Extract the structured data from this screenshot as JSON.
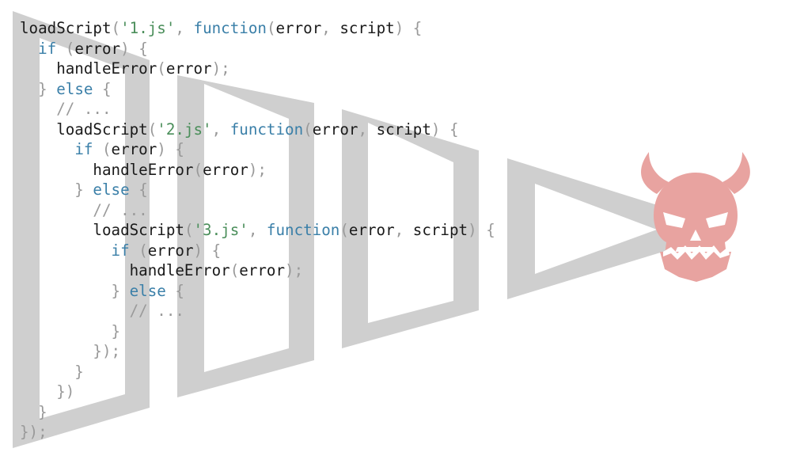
{
  "colors": {
    "pyramid_fill": "#cfcfcf",
    "skull_fill": "#e8a3a0",
    "skull_dark": "#ffffff"
  },
  "icons": {
    "skull": "demon-skull-icon",
    "pyramid": "pyramid-of-doom-shape"
  },
  "code_lines": [
    [
      {
        "t": "loadScript",
        "k": "plain"
      },
      {
        "t": "(",
        "k": "punct"
      },
      {
        "t": "'1.js'",
        "k": "string"
      },
      {
        "t": ", ",
        "k": "punct"
      },
      {
        "t": "function",
        "k": "keyword"
      },
      {
        "t": "(",
        "k": "punct"
      },
      {
        "t": "error",
        "k": "plain"
      },
      {
        "t": ", ",
        "k": "punct"
      },
      {
        "t": "script",
        "k": "plain"
      },
      {
        "t": ") {",
        "k": "punct"
      }
    ],
    [
      {
        "t": "  ",
        "k": "plain"
      },
      {
        "t": "if",
        "k": "keyword"
      },
      {
        "t": " (",
        "k": "punct"
      },
      {
        "t": "error",
        "k": "plain"
      },
      {
        "t": ") {",
        "k": "punct"
      }
    ],
    [
      {
        "t": "    handleError",
        "k": "plain"
      },
      {
        "t": "(",
        "k": "punct"
      },
      {
        "t": "error",
        "k": "plain"
      },
      {
        "t": ");",
        "k": "punct"
      }
    ],
    [
      {
        "t": "  } ",
        "k": "punct"
      },
      {
        "t": "else",
        "k": "keyword"
      },
      {
        "t": " {",
        "k": "punct"
      }
    ],
    [
      {
        "t": "    // ...",
        "k": "comment"
      }
    ],
    [
      {
        "t": "    loadScript",
        "k": "plain"
      },
      {
        "t": "(",
        "k": "punct"
      },
      {
        "t": "'2.js'",
        "k": "string"
      },
      {
        "t": ", ",
        "k": "punct"
      },
      {
        "t": "function",
        "k": "keyword"
      },
      {
        "t": "(",
        "k": "punct"
      },
      {
        "t": "error",
        "k": "plain"
      },
      {
        "t": ", ",
        "k": "punct"
      },
      {
        "t": "script",
        "k": "plain"
      },
      {
        "t": ") {",
        "k": "punct"
      }
    ],
    [
      {
        "t": "      ",
        "k": "plain"
      },
      {
        "t": "if",
        "k": "keyword"
      },
      {
        "t": " (",
        "k": "punct"
      },
      {
        "t": "error",
        "k": "plain"
      },
      {
        "t": ") {",
        "k": "punct"
      }
    ],
    [
      {
        "t": "        handleError",
        "k": "plain"
      },
      {
        "t": "(",
        "k": "punct"
      },
      {
        "t": "error",
        "k": "plain"
      },
      {
        "t": ");",
        "k": "punct"
      }
    ],
    [
      {
        "t": "      } ",
        "k": "punct"
      },
      {
        "t": "else",
        "k": "keyword"
      },
      {
        "t": " {",
        "k": "punct"
      }
    ],
    [
      {
        "t": "        // ...",
        "k": "comment"
      }
    ],
    [
      {
        "t": "        loadScript",
        "k": "plain"
      },
      {
        "t": "(",
        "k": "punct"
      },
      {
        "t": "'3.js'",
        "k": "string"
      },
      {
        "t": ", ",
        "k": "punct"
      },
      {
        "t": "function",
        "k": "keyword"
      },
      {
        "t": "(",
        "k": "punct"
      },
      {
        "t": "error",
        "k": "plain"
      },
      {
        "t": ", ",
        "k": "punct"
      },
      {
        "t": "script",
        "k": "plain"
      },
      {
        "t": ") {",
        "k": "punct"
      }
    ],
    [
      {
        "t": "          ",
        "k": "plain"
      },
      {
        "t": "if",
        "k": "keyword"
      },
      {
        "t": " (",
        "k": "punct"
      },
      {
        "t": "error",
        "k": "plain"
      },
      {
        "t": ") {",
        "k": "punct"
      }
    ],
    [
      {
        "t": "            handleError",
        "k": "plain"
      },
      {
        "t": "(",
        "k": "punct"
      },
      {
        "t": "error",
        "k": "plain"
      },
      {
        "t": ");",
        "k": "punct"
      }
    ],
    [
      {
        "t": "          } ",
        "k": "punct"
      },
      {
        "t": "else",
        "k": "keyword"
      },
      {
        "t": " {",
        "k": "punct"
      }
    ],
    [
      {
        "t": "            // ...",
        "k": "comment"
      }
    ],
    [
      {
        "t": "          }",
        "k": "punct"
      }
    ],
    [
      {
        "t": "        });",
        "k": "punct"
      }
    ],
    [
      {
        "t": "      }",
        "k": "punct"
      }
    ],
    [
      {
        "t": "    })",
        "k": "punct"
      }
    ],
    [
      {
        "t": "  }",
        "k": "punct"
      }
    ],
    [
      {
        "t": "});",
        "k": "punct"
      }
    ]
  ]
}
